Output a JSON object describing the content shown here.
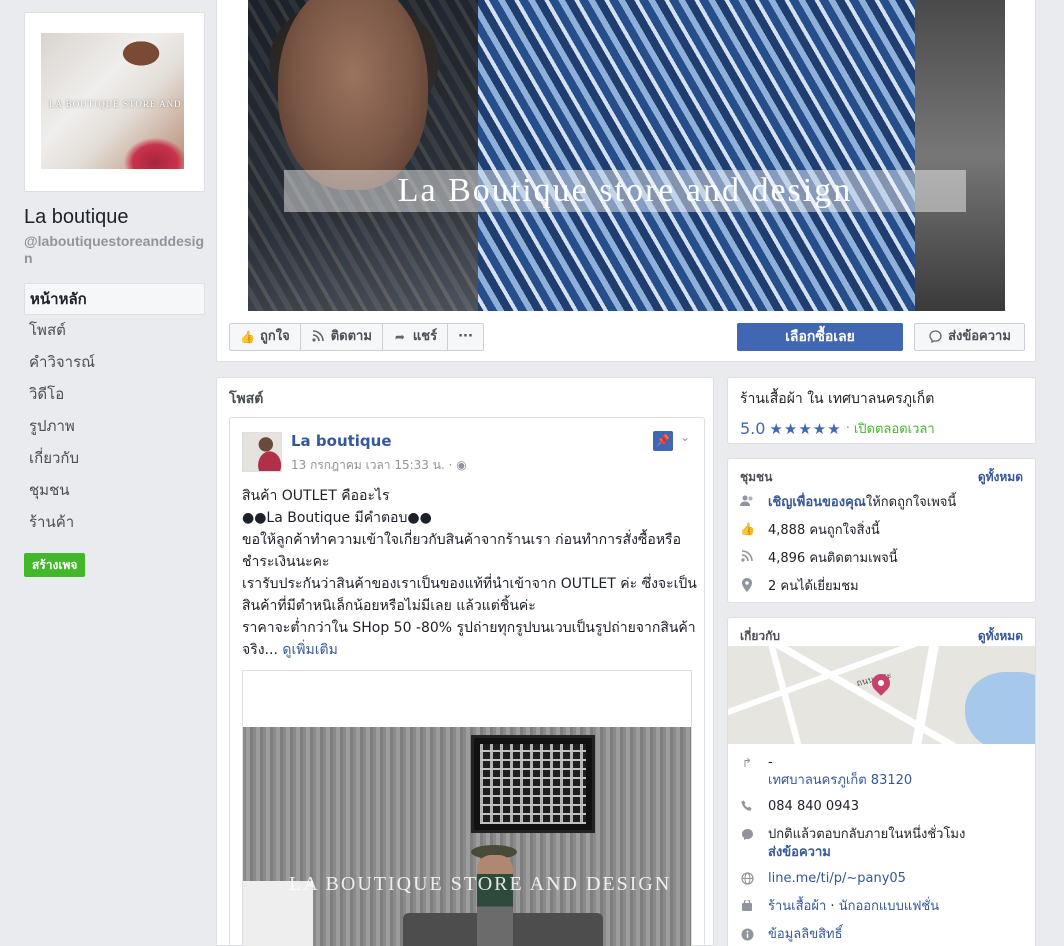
{
  "page": {
    "name": "La boutique",
    "handle": "@laboutiquestoreanddesign",
    "profile_watermark": "LA BOUTIQUE STORE AND DESIGN"
  },
  "nav": {
    "items": [
      "หน้าหลัก",
      "โพสต์",
      "คำวิจารณ์",
      "วิดีโอ",
      "รูปภาพ",
      "เกี่ยวกับ",
      "ชุมชน",
      "ร้านค้า"
    ],
    "active_index": 0,
    "create_page": "สร้างเพจ"
  },
  "cover": {
    "title": "La Boutique store and design"
  },
  "actions": {
    "like": "ถูกใจ",
    "follow": "ติดตาม",
    "share": "แชร์",
    "more": "···",
    "shop_now": "เลือกซื้อเลย",
    "send_message": "ส่งข้อความ"
  },
  "posts": {
    "section_title": "โพสต์",
    "post": {
      "author": "La boutique",
      "meta": "13 กรกฎาคม เวลา 15:33 น. · ",
      "lines": [
        "สินค้า OUTLET คืออะไร",
        "●●La Boutique มีคำตอบ●●",
        "ขอให้ลูกค้าทำความเข้าใจเกี่ยวกับสินค้าจากร้านเรา ก่อนทำการสั่งซื้อหรือชำระเงินนะคะ",
        "เรารับประกันว่าสินค้าของเราเป็นของแท้ที่นำเข้าจาก OUTLET ค่ะ ซึ่งจะเป็นสินค้าที่มีตำหนิเล็กน้อยหรือไม่มีเลย แล้วแต่ชิ้นค่ะ",
        "ราคาจะต่ำกว่าใน SHop 50 -80% รูปถ่ายทุกรูปบนเวบเป็นรูปถ่ายจากสินค้าจริง..."
      ],
      "see_more": "ดูเพิ่มเติม",
      "image_watermark": "LA BOUTIQUE STORE AND DESIGN"
    }
  },
  "store": {
    "category": "ร้านเสื้อผ้า ใน เทศบาลนครภูเก็ต",
    "rating": "5.0",
    "stars": "★★★★★",
    "separator": " · ",
    "status": "เปิดตลอดเวลา"
  },
  "community": {
    "title": "ชุมชน",
    "see_all": "ดูทั้งหมด",
    "invite_link": "เชิญเพื่อนของคุณ",
    "invite_rest": " ให้กดถูกใจเพจนี้",
    "likes": "4,888 คนถูกใจสิ่งนี้",
    "follows": "4,896 คนติดตามเพจนี้",
    "checkins": "2 คนได้เยี่ยมชม"
  },
  "about": {
    "title": "เกี่ยวกับ",
    "see_all": "ดูทั้งหมด",
    "map_road_label": "ถนน กระ",
    "address_line1": "-",
    "address_line2": "เทศบาลนครภูเก็ต 83120",
    "phone": "084 840 0943",
    "response": "ปกติแล้วตอบกลับภายในหนึ่งชั่วโมง",
    "send_message": "ส่งข้อความ",
    "website": "line.me/ti/p/~pany05",
    "category_link": "ร้านเสื้อผ้า",
    "category_sep": " · ",
    "category_link2": "นักออกแบบแฟชั่น",
    "copyright": "ข้อมูลลิขสิทธิ์"
  },
  "colors": {
    "fb_blue": "#4267b2",
    "link_blue": "#365899",
    "green": "#42b72a",
    "background": "#e9ebee"
  }
}
